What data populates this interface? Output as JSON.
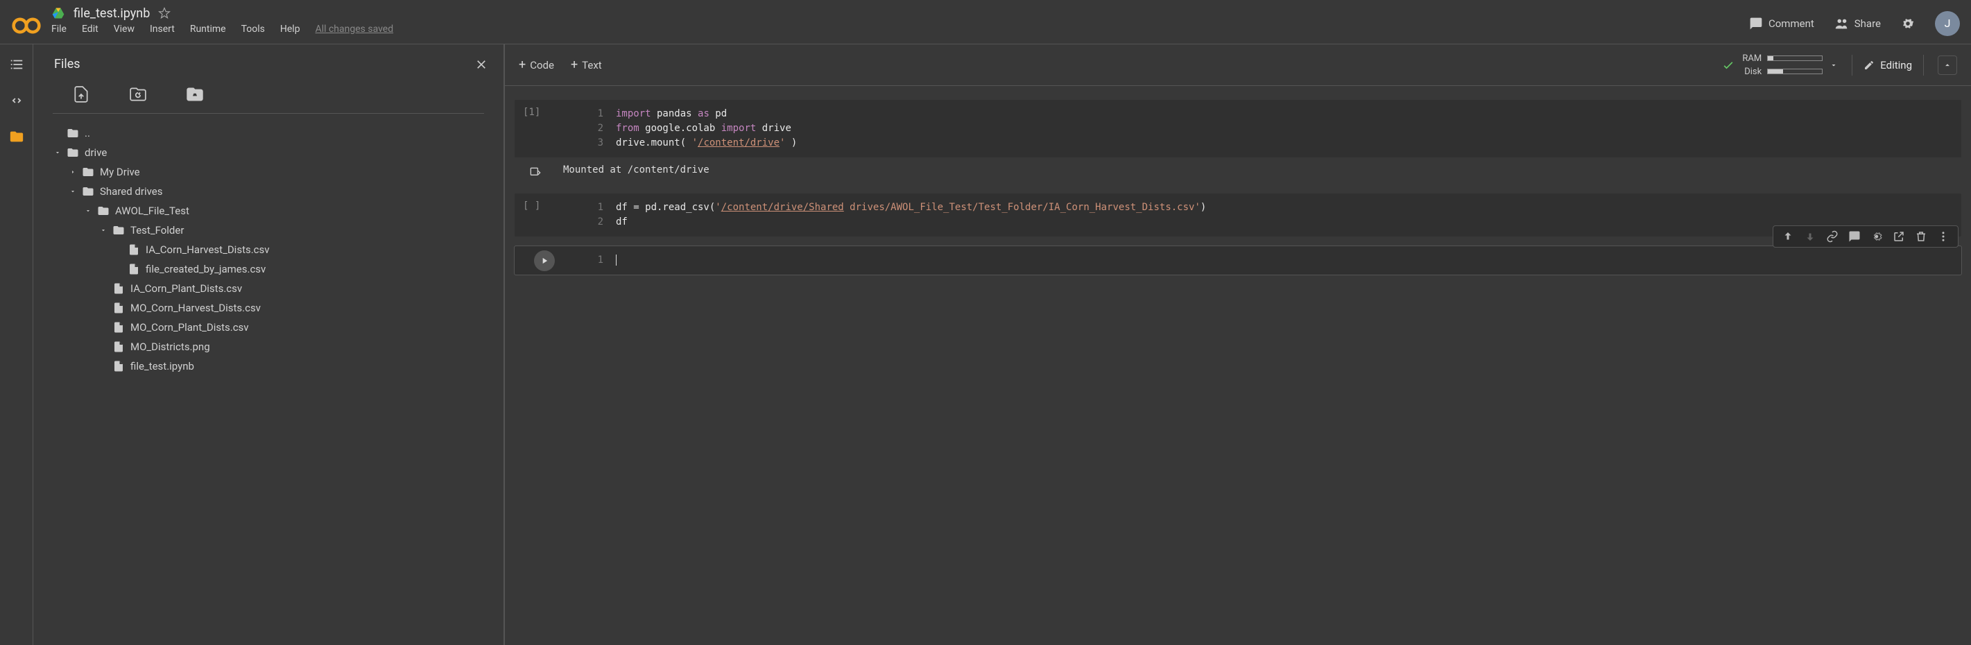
{
  "header": {
    "filename": "file_test.ipynb",
    "menus": [
      "File",
      "Edit",
      "View",
      "Insert",
      "Runtime",
      "Tools",
      "Help"
    ],
    "saved_status": "All changes saved",
    "comment": "Comment",
    "share": "Share",
    "avatar_initial": "J"
  },
  "files_panel": {
    "title": "Files",
    "tree": [
      {
        "indent": 0,
        "type": "up",
        "label": ".."
      },
      {
        "indent": 0,
        "type": "folder",
        "label": "drive",
        "expanded": true
      },
      {
        "indent": 1,
        "type": "folder",
        "label": "My Drive",
        "expanded": false
      },
      {
        "indent": 1,
        "type": "folder",
        "label": "Shared drives",
        "expanded": true
      },
      {
        "indent": 2,
        "type": "folder",
        "label": "AWOL_File_Test",
        "expanded": true
      },
      {
        "indent": 3,
        "type": "folder",
        "label": "Test_Folder",
        "expanded": true
      },
      {
        "indent": 4,
        "type": "file",
        "label": "IA_Corn_Harvest_Dists.csv"
      },
      {
        "indent": 4,
        "type": "file",
        "label": "file_created_by_james.csv"
      },
      {
        "indent": 3,
        "type": "file",
        "label": "IA_Corn_Plant_Dists.csv"
      },
      {
        "indent": 3,
        "type": "file",
        "label": "MO_Corn_Harvest_Dists.csv"
      },
      {
        "indent": 3,
        "type": "file",
        "label": "MO_Corn_Plant_Dists.csv"
      },
      {
        "indent": 3,
        "type": "file",
        "label": "MO_Districts.png"
      },
      {
        "indent": 3,
        "type": "file",
        "label": "file_test.ipynb"
      }
    ]
  },
  "toolbar": {
    "code": "Code",
    "text": "Text",
    "ram_label": "RAM",
    "disk_label": "Disk",
    "ram_pct": 10,
    "disk_pct": 28,
    "editing": "Editing"
  },
  "cells": [
    {
      "prompt": "[1]",
      "lines": [
        {
          "n": "1",
          "html": "<span class='kw-import'>import</span> pandas <span class='kw-as'>as</span> pd"
        },
        {
          "n": "2",
          "html": "<span class='kw-import'>from</span> google.colab <span class='kw-import'>import</span> drive"
        },
        {
          "n": "3",
          "html": "drive.mount( <span class='str'>'<span class='underline'>/content/drive</span>'</span> )"
        }
      ],
      "output": "Mounted at /content/drive"
    },
    {
      "prompt": "[ ]",
      "lines": [
        {
          "n": "1",
          "html": "df = pd.read_csv(<span class='str'>'<span class='underline'>/content/drive/Shared</span> drives/AWOL_File_Test/Test_Folder/IA_Corn_Harvest_Dists.csv'</span>)"
        },
        {
          "n": "2",
          "html": "df"
        }
      ]
    },
    {
      "prompt": "run",
      "active": true,
      "lines": [
        {
          "n": "1",
          "html": "<span class='cursor-line'></span>"
        }
      ]
    }
  ]
}
